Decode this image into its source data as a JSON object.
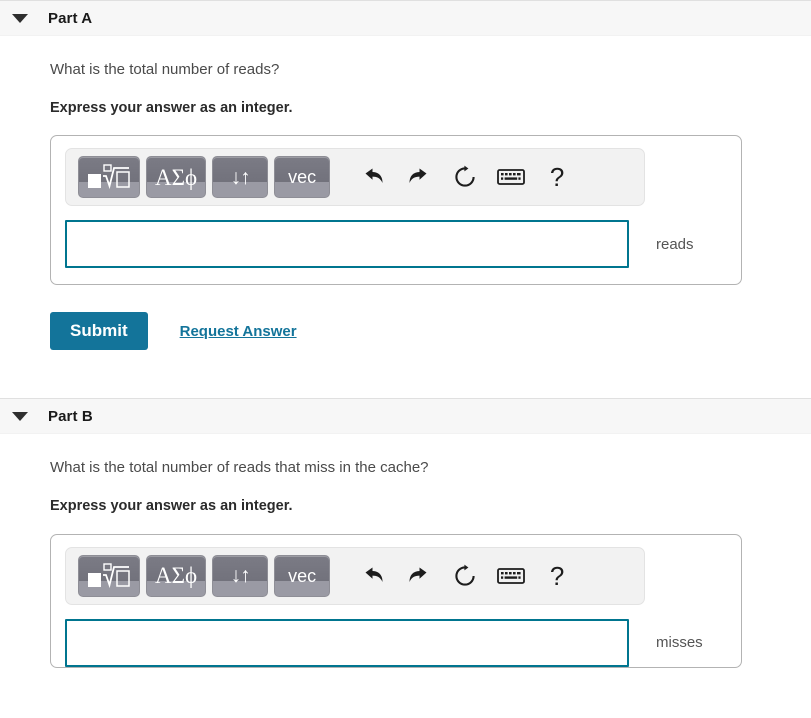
{
  "parts": [
    {
      "id": "part-a",
      "title": "Part A",
      "caret_icon": "caret-down-icon",
      "question": "What is the total number of reads?",
      "instruction": "Express your answer as an integer.",
      "toolbar": {
        "template_button": {
          "icon": "math-template-icon",
          "label": ""
        },
        "greek_button": {
          "icon": "greek-letters-icon",
          "label": "ΑΣϕ"
        },
        "arrows_button": {
          "icon": "updown-arrows-icon",
          "label": "↓↑"
        },
        "vec_button": {
          "icon": "vector-icon",
          "label": "vec"
        },
        "undo_button": {
          "icon": "undo-icon"
        },
        "redo_button": {
          "icon": "redo-icon"
        },
        "reset_button": {
          "icon": "reset-icon"
        },
        "keyboard_button": {
          "icon": "keyboard-icon"
        },
        "help_button": {
          "icon": "help-icon",
          "label": "?"
        }
      },
      "input": {
        "value": "",
        "placeholder": ""
      },
      "unit": "reads",
      "submit_label": "Submit",
      "request_answer_label": "Request Answer"
    },
    {
      "id": "part-b",
      "title": "Part B",
      "caret_icon": "caret-down-icon",
      "question": "What is the total number of reads that miss in the cache?",
      "instruction": "Express your answer as an integer.",
      "toolbar": {
        "template_button": {
          "icon": "math-template-icon",
          "label": ""
        },
        "greek_button": {
          "icon": "greek-letters-icon",
          "label": "ΑΣϕ"
        },
        "arrows_button": {
          "icon": "updown-arrows-icon",
          "label": "↓↑"
        },
        "vec_button": {
          "icon": "vector-icon",
          "label": "vec"
        },
        "undo_button": {
          "icon": "undo-icon"
        },
        "redo_button": {
          "icon": "redo-icon"
        },
        "reset_button": {
          "icon": "reset-icon"
        },
        "keyboard_button": {
          "icon": "keyboard-icon"
        },
        "help_button": {
          "icon": "help-icon",
          "label": "?"
        }
      },
      "input": {
        "value": "",
        "placeholder": ""
      },
      "unit": "misses"
    }
  ],
  "colors": {
    "accent_teal": "#13749a",
    "input_border": "#00758f",
    "header_band": "#f7f7f7",
    "toolbar_bg": "#f2f2f2",
    "button_gray": "#72727c"
  }
}
